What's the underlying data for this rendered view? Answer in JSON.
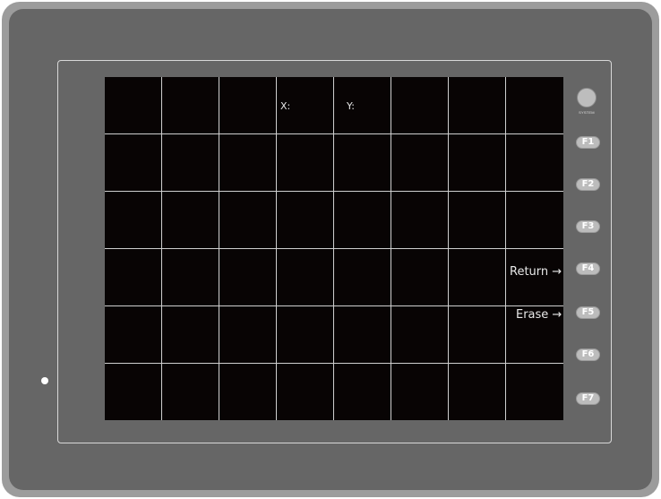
{
  "screen": {
    "coord_x_label": "X:",
    "coord_y_label": "Y:",
    "return_label": "Return →",
    "erase_label": "Erase →",
    "grid": {
      "columns": 8,
      "rows": 6
    }
  },
  "side_panel": {
    "system_label": "SYSTEM",
    "function_keys": [
      "F1",
      "F2",
      "F3",
      "F4",
      "F5",
      "F6",
      "F7"
    ]
  },
  "colors": {
    "housing": "#666666",
    "screen": "#080404",
    "grid": "#cfcfcf",
    "key": "#bcbcbc"
  }
}
